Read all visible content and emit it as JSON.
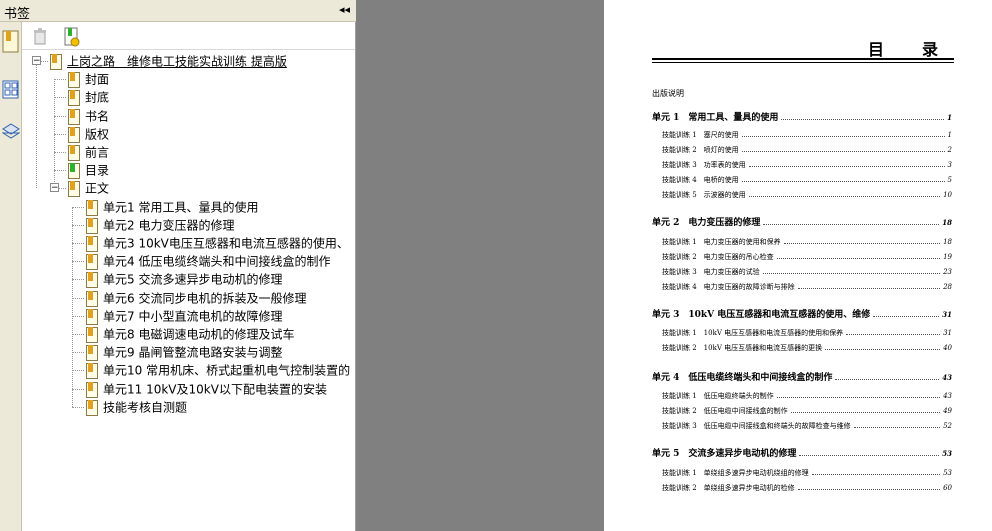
{
  "panel": {
    "title": "书签",
    "collapse_glyph": "◂◂",
    "strip_icons": [
      "bookmark-panel-icon",
      "thumbnails-icon",
      "layers-icon"
    ],
    "toolbar_icons": [
      "delete-icon",
      "new-bookmark-icon"
    ]
  },
  "tree": [
    {
      "label": "上岗之路　维修电工技能实战训练 提高版",
      "level": 0,
      "toggle": "−"
    },
    {
      "label": "封面",
      "level": 1
    },
    {
      "label": "封底",
      "level": 1
    },
    {
      "label": "书名",
      "level": 1
    },
    {
      "label": "版权",
      "level": 1
    },
    {
      "label": "前言",
      "level": 1
    },
    {
      "label": "目录",
      "level": 1,
      "green": true
    },
    {
      "label": "正文",
      "level": 1,
      "toggle": "−"
    },
    {
      "label": "单元1  常用工具、量具的使用",
      "level": 2
    },
    {
      "label": "单元2  电力变压器的修理",
      "level": 2
    },
    {
      "label": "单元3  10kV电压互感器和电流互感器的使用、",
      "level": 2
    },
    {
      "label": "单元4  低压电缆终端头和中间接线盒的制作",
      "level": 2
    },
    {
      "label": "单元5  交流多速异步电动机的修理",
      "level": 2
    },
    {
      "label": "单元6  交流同步电机的拆装及一般修理",
      "level": 2
    },
    {
      "label": "单元7  中小型直流电机的故障修理",
      "level": 2
    },
    {
      "label": "单元8  电磁调速电动机的修理及试车",
      "level": 2
    },
    {
      "label": "单元9  晶闸管整流电路安装与调整",
      "level": 2
    },
    {
      "label": "单元10  常用机床、桥式起重机电气控制装置的",
      "level": 2
    },
    {
      "label": "单元11  10kV及10kV以下配电装置的安装",
      "level": 2
    },
    {
      "label": "技能考核自测题",
      "level": 2
    }
  ],
  "page": {
    "title": "目录",
    "entries": [
      {
        "kind": "plain",
        "text": "出版说明",
        "page": ""
      },
      {
        "kind": "unit",
        "text": "单元 1　常用工具、量具的使用",
        "page": "1"
      },
      {
        "kind": "sub",
        "text": "技能训练 1　塞尺的使用",
        "page": "1"
      },
      {
        "kind": "sub",
        "text": "技能训练 2　喷灯的使用",
        "page": "2"
      },
      {
        "kind": "sub",
        "text": "技能训练 3　功率表的使用",
        "page": "3"
      },
      {
        "kind": "sub",
        "text": "技能训练 4　电桥的使用",
        "page": "5"
      },
      {
        "kind": "sub",
        "text": "技能训练 5　示波器的使用",
        "page": "10"
      },
      {
        "kind": "unit",
        "text": "单元 2　电力变压器的修理",
        "page": "18"
      },
      {
        "kind": "sub",
        "text": "技能训练 1　电力变压器的使用和保养",
        "page": "18"
      },
      {
        "kind": "sub",
        "text": "技能训练 2　电力变压器的吊心检查",
        "page": "19"
      },
      {
        "kind": "sub",
        "text": "技能训练 3　电力变压器的试验",
        "page": "23"
      },
      {
        "kind": "sub",
        "text": "技能训练 4　电力变压器的故障诊断与排除",
        "page": "28"
      },
      {
        "kind": "unit",
        "text": "单元 3　10kV 电压互感器和电流互感器的使用、维修",
        "page": "31"
      },
      {
        "kind": "sub",
        "text": "技能训练 1　10kV 电压互感器和电流互感器的使用和保养",
        "page": "31"
      },
      {
        "kind": "sub",
        "text": "技能训练 2　10kV 电压互感器和电流互感器的更换",
        "page": "40"
      },
      {
        "kind": "unit",
        "text": "单元 4　低压电缆终端头和中间接线盒的制作",
        "page": "43"
      },
      {
        "kind": "sub",
        "text": "技能训练 1　低压电缆终端头的制作",
        "page": "43"
      },
      {
        "kind": "sub",
        "text": "技能训练 2　低压电缆中间接线盒的制作",
        "page": "49"
      },
      {
        "kind": "sub",
        "text": "技能训练 3　低压电缆中间接线盒和终端头的故障检查与维修",
        "page": "52"
      },
      {
        "kind": "unit",
        "text": "单元 5　交流多速异步电动机的修理",
        "page": "53"
      },
      {
        "kind": "sub",
        "text": "技能训练 1　单绕组多速异步电动机绕组的修理",
        "page": "53"
      },
      {
        "kind": "sub",
        "text": "技能训练 2　单绕组多速异步电动机的检修",
        "page": "60"
      }
    ]
  }
}
